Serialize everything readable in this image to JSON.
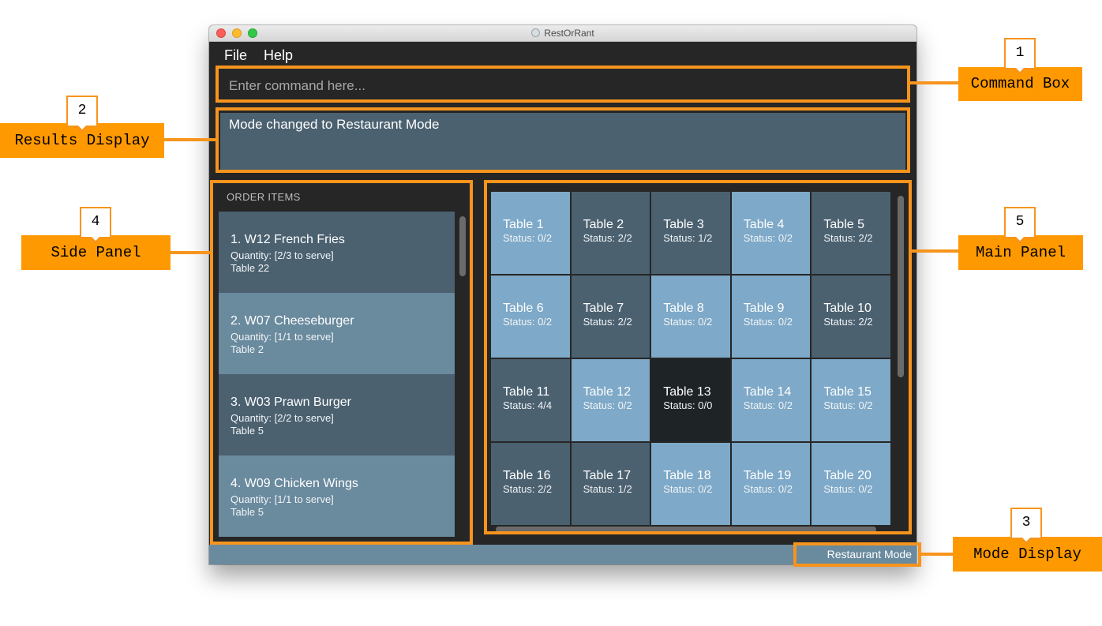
{
  "window": {
    "title": "RestOrRant"
  },
  "menu": [
    "File",
    "Help"
  ],
  "command_box": {
    "placeholder": "Enter command here...",
    "value": ""
  },
  "result_display": {
    "text": "Mode changed to Restaurant Mode"
  },
  "side_panel": {
    "header": "ORDER ITEMS",
    "items": [
      {
        "name": "1.  W12 French Fries",
        "quantity": "Quantity: [2/3 to serve]",
        "table": "Table 22"
      },
      {
        "name": "2.  W07 Cheeseburger",
        "quantity": "Quantity: [1/1 to serve]",
        "table": "Table 2"
      },
      {
        "name": "3.  W03 Prawn Burger",
        "quantity": "Quantity: [2/2 to serve]",
        "table": "Table 5"
      },
      {
        "name": "4.  W09 Chicken Wings",
        "quantity": "Quantity: [1/1 to serve]",
        "table": "Table 5"
      }
    ]
  },
  "main_panel": {
    "tables": [
      {
        "name": "Table 1",
        "status": "Status: 0/2",
        "state": "free"
      },
      {
        "name": "Table 2",
        "status": "Status: 2/2",
        "state": "busy"
      },
      {
        "name": "Table 3",
        "status": "Status: 1/2",
        "state": "busy"
      },
      {
        "name": "Table 4",
        "status": "Status: 0/2",
        "state": "free"
      },
      {
        "name": "Table 5",
        "status": "Status: 2/2",
        "state": "busy"
      },
      {
        "name": "Table 6",
        "status": "Status: 0/2",
        "state": "free"
      },
      {
        "name": "Table 7",
        "status": "Status: 2/2",
        "state": "busy"
      },
      {
        "name": "Table 8",
        "status": "Status: 0/2",
        "state": "free"
      },
      {
        "name": "Table 9",
        "status": "Status: 0/2",
        "state": "free"
      },
      {
        "name": "Table 10",
        "status": "Status: 2/2",
        "state": "busy"
      },
      {
        "name": "Table 11",
        "status": "Status: 4/4",
        "state": "busy"
      },
      {
        "name": "Table 12",
        "status": "Status: 0/2",
        "state": "free"
      },
      {
        "name": "Table 13",
        "status": "Status: 0/0",
        "state": "idle"
      },
      {
        "name": "Table 14",
        "status": "Status: 0/2",
        "state": "free"
      },
      {
        "name": "Table 15",
        "status": "Status: 0/2",
        "state": "free"
      },
      {
        "name": "Table 16",
        "status": "Status: 2/2",
        "state": "busy"
      },
      {
        "name": "Table 17",
        "status": "Status: 1/2",
        "state": "busy"
      },
      {
        "name": "Table 18",
        "status": "Status: 0/2",
        "state": "free"
      },
      {
        "name": "Table 19",
        "status": "Status: 0/2",
        "state": "free"
      },
      {
        "name": "Table 20",
        "status": "Status: 0/2",
        "state": "free"
      }
    ]
  },
  "status_bar": {
    "mode": "Restaurant Mode"
  },
  "annotations": [
    {
      "number": "1",
      "label": "Command Box"
    },
    {
      "number": "2",
      "label": "Results Display"
    },
    {
      "number": "3",
      "label": "Mode Display"
    },
    {
      "number": "4",
      "label": "Side Panel"
    },
    {
      "number": "5",
      "label": "Main Panel"
    }
  ],
  "colors": {
    "annotation_orange": "#f7941d",
    "callout_fill": "#fe9901",
    "panel_dark": "#262626",
    "card_dark": "#4b6170",
    "card_light": "#6a8a9e",
    "table_free": "#7ea9c8",
    "table_idle": "#1e2326"
  }
}
